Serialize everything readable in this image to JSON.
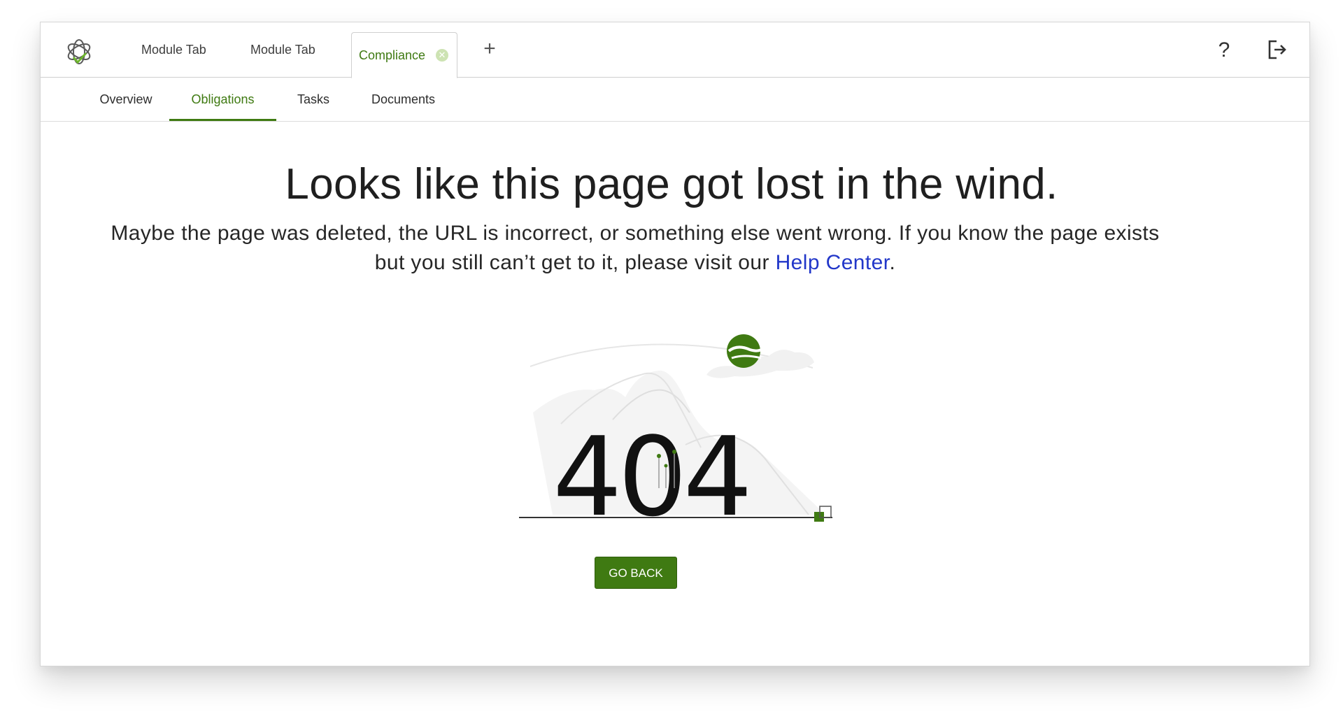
{
  "tabs": {
    "module_tab_1": "Module Tab",
    "module_tab_2": "Module Tab",
    "active_tab": "Compliance",
    "close_icon": "x-circle-icon",
    "add_icon": "plus-icon"
  },
  "header_actions": {
    "help_label": "?",
    "help_icon": "question-mark-icon",
    "logout_icon": "logout-icon"
  },
  "subnav": {
    "items": [
      "Overview",
      "Obligations",
      "Tasks",
      "Documents"
    ],
    "selected": "Obligations"
  },
  "error_page": {
    "headline": "Looks like this page got lost in the wind.",
    "message_before_link": "Maybe the page was deleted, the URL is incorrect, or something else went wrong. If you know the page exists but you still can’t get to it, please visit our ",
    "link_text": "Help Center",
    "message_after_link": ".",
    "code": "404",
    "button_label": "GO BACK"
  },
  "colors": {
    "accent": "#3f7a12",
    "link": "#2237c9",
    "text": "#1f1f1f"
  }
}
